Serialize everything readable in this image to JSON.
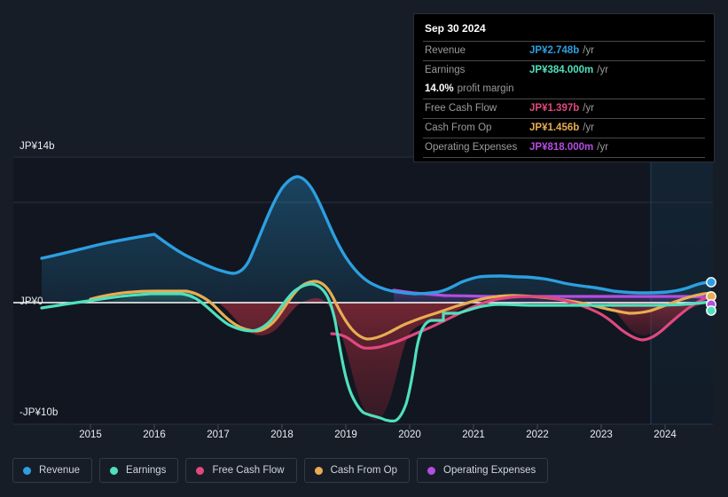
{
  "colors": {
    "background": "#171d27",
    "revenue": "#2c9fe0",
    "earnings": "#4fe0bd",
    "free_cash_flow": "#e0487f",
    "cash_from_op": "#e8ad52",
    "operating_expenses": "#b44de0",
    "zero_line": "#ffffff",
    "grid": "#2b3240",
    "tooltip_bg": "#000000"
  },
  "tooltip": {
    "date": "Sep 30 2024",
    "rows": [
      {
        "label": "Revenue",
        "value": "JP¥2.748b",
        "unit": "/yr",
        "color": "#2c9fe0"
      },
      {
        "label": "Earnings",
        "value": "JP¥384.000m",
        "unit": "/yr",
        "color": "#4fe0bd"
      },
      {
        "label": "",
        "value": "14.0%",
        "unit": "profit margin",
        "color": "#ffffff"
      },
      {
        "label": "Free Cash Flow",
        "value": "JP¥1.397b",
        "unit": "/yr",
        "color": "#e0487f"
      },
      {
        "label": "Cash From Op",
        "value": "JP¥1.456b",
        "unit": "/yr",
        "color": "#e8ad52"
      },
      {
        "label": "Operating Expenses",
        "value": "JP¥818.000m",
        "unit": "/yr",
        "color": "#b44de0"
      }
    ]
  },
  "legend": {
    "items": [
      {
        "label": "Revenue",
        "color": "#2c9fe0"
      },
      {
        "label": "Earnings",
        "color": "#4fe0bd"
      },
      {
        "label": "Free Cash Flow",
        "color": "#e0487f"
      },
      {
        "label": "Cash From Op",
        "color": "#e8ad52"
      },
      {
        "label": "Operating Expenses",
        "color": "#b44de0"
      }
    ]
  },
  "axes": {
    "y_top_label": "JP¥14b",
    "y_zero_label": "JP¥0",
    "y_bottom_label": "-JP¥10b",
    "x_ticks": [
      "2015",
      "2016",
      "2017",
      "2018",
      "2019",
      "2020",
      "2021",
      "2022",
      "2023",
      "2024"
    ]
  },
  "chart_data": {
    "type": "area",
    "title": "",
    "xlabel": "",
    "ylabel": "JP¥",
    "ylim": [
      -10,
      14
    ],
    "y_gridlines": [
      14,
      10.5,
      0
    ],
    "grid": true,
    "legend_position": "bottom",
    "x": [
      2014.45,
      2015,
      2015.5,
      2016,
      2016.5,
      2017,
      2017.25,
      2017.5,
      2018,
      2018.3,
      2018.7,
      2019,
      2019.3,
      2019.6,
      2020,
      2020.5,
      2021,
      2021.3,
      2021.6,
      2022,
      2022.5,
      2023,
      2023.5,
      2024,
      2024.75
    ],
    "forecast_start": 2023.9,
    "series": [
      {
        "name": "Revenue",
        "color": "#2c9fe0",
        "values": [
          4.0,
          4.8,
          5.4,
          6.2,
          5.7,
          4.8,
          4.6,
          5.2,
          10.5,
          13.3,
          10.5,
          6.2,
          4.7,
          3.6,
          3.0,
          3.0,
          3.1,
          3.7,
          4.0,
          3.9,
          3.6,
          3.2,
          2.9,
          2.9,
          2.748
        ]
      },
      {
        "name": "Earnings",
        "color": "#4fe0bd",
        "values": [
          -0.5,
          0.3,
          0.8,
          1.0,
          1.0,
          -0.2,
          -1.2,
          -1.3,
          -0.3,
          1.4,
          0.9,
          -5.6,
          -8.6,
          -9.9,
          -5.6,
          -0.3,
          0.15,
          0.2,
          0.1,
          0.1,
          0.1,
          0.1,
          0.2,
          0.3,
          0.384
        ]
      },
      {
        "name": "Free Cash Flow",
        "color": "#e0487f",
        "values": [
          null,
          null,
          null,
          null,
          null,
          null,
          null,
          null,
          null,
          null,
          -1.4,
          -2.1,
          -2.3,
          -2.1,
          -1.6,
          -0.5,
          0.2,
          0.5,
          0.55,
          0.3,
          0.0,
          -0.4,
          -1.5,
          -0.5,
          1.397
        ]
      },
      {
        "name": "Cash From Op",
        "color": "#e8ad52",
        "values": [
          null,
          0.35,
          0.9,
          1.05,
          1.05,
          -0.1,
          -1.1,
          -1.2,
          -0.1,
          1.6,
          1.1,
          -1.1,
          -1.7,
          -1.6,
          -1.2,
          -0.25,
          0.3,
          0.55,
          0.6,
          0.4,
          0.1,
          -0.3,
          -0.6,
          -0.3,
          1.456
        ]
      },
      {
        "name": "Operating Expenses",
        "color": "#b44de0",
        "values": [
          null,
          null,
          null,
          null,
          null,
          null,
          null,
          null,
          null,
          null,
          null,
          null,
          null,
          0.95,
          0.85,
          0.8,
          0.78,
          0.78,
          0.78,
          0.78,
          0.78,
          0.78,
          0.78,
          0.78,
          0.818
        ]
      }
    ],
    "endpoints": [
      {
        "name": "Revenue",
        "color": "#2c9fe0"
      },
      {
        "name": "Cash From Op",
        "color": "#e8ad52"
      },
      {
        "name": "Operating Expenses",
        "color": "#b44de0"
      },
      {
        "name": "Earnings",
        "color": "#4fe0bd"
      }
    ]
  }
}
